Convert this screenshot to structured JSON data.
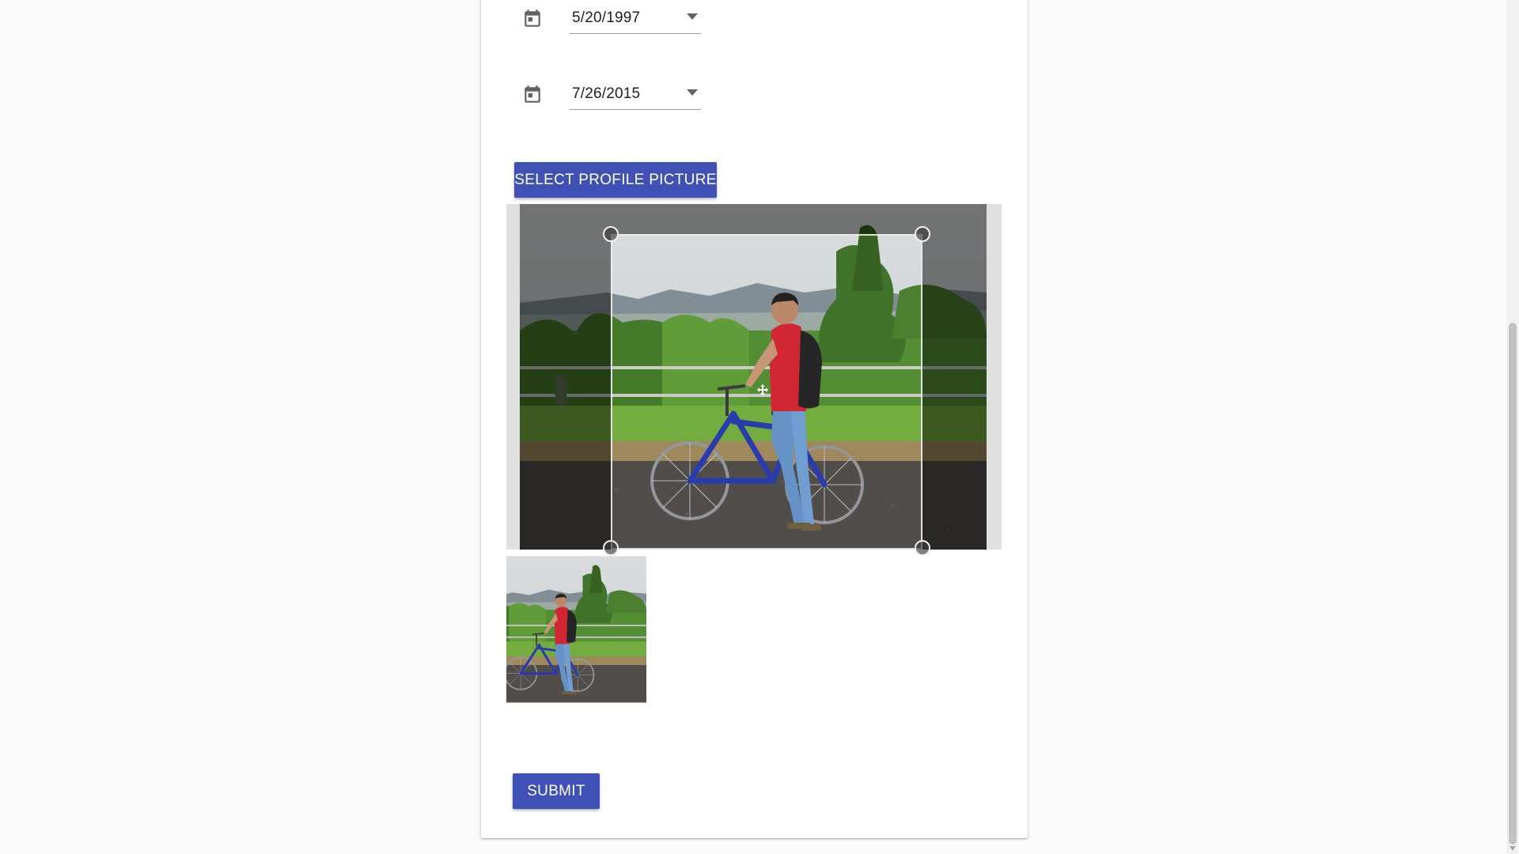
{
  "form": {
    "start_date": {
      "value": "5/20/1997",
      "icon": "calendar-icon"
    },
    "end_date": {
      "value": "7/26/2015",
      "icon": "calendar-icon"
    },
    "select_picture_label": "SELECT PROFILE PICTURE",
    "submit_label": "SUBMIT"
  },
  "cropper": {
    "image_alt": "Person in red shirt with backpack standing beside a blue bicycle near a fence with greenery and hills"
  },
  "colors": {
    "primary": "#3f51b5",
    "page_background": "#fafafa",
    "card_background": "#ffffff",
    "icon": "#616161"
  }
}
